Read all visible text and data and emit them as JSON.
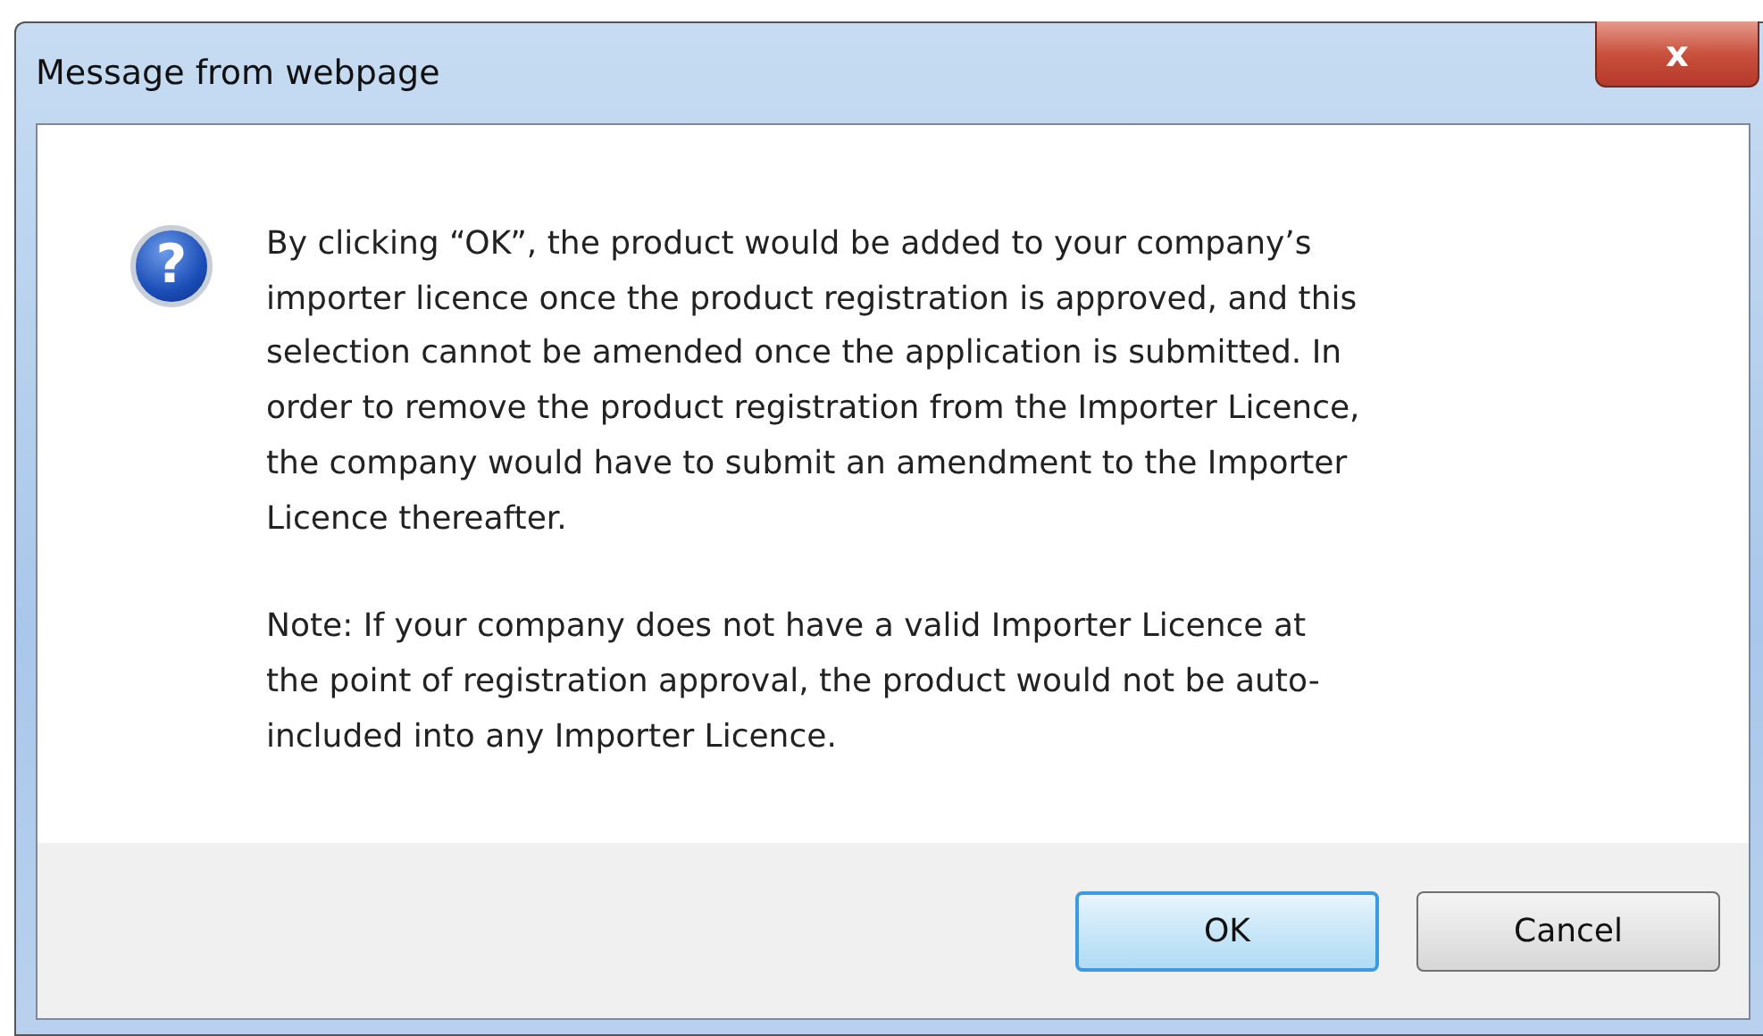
{
  "window": {
    "title": "Message from webpage",
    "close_label": "x"
  },
  "message": {
    "icon_glyph": "?",
    "paragraphs": [
      "By clicking “OK”, the product would be added to your company’s importer licence once the product registration is approved, and this selection cannot be amended once the application is submitted. In order to remove the product registration from the Importer Licence, the company would have to submit an amendment to the Importer Licence thereafter.",
      "Note: If your company does not have a valid Importer Licence at the point of registration approval, the product would not be auto-included into any Importer Licence."
    ]
  },
  "buttons": [
    {
      "label": "OK",
      "default": true
    },
    {
      "label": "Cancel",
      "default": false
    }
  ]
}
